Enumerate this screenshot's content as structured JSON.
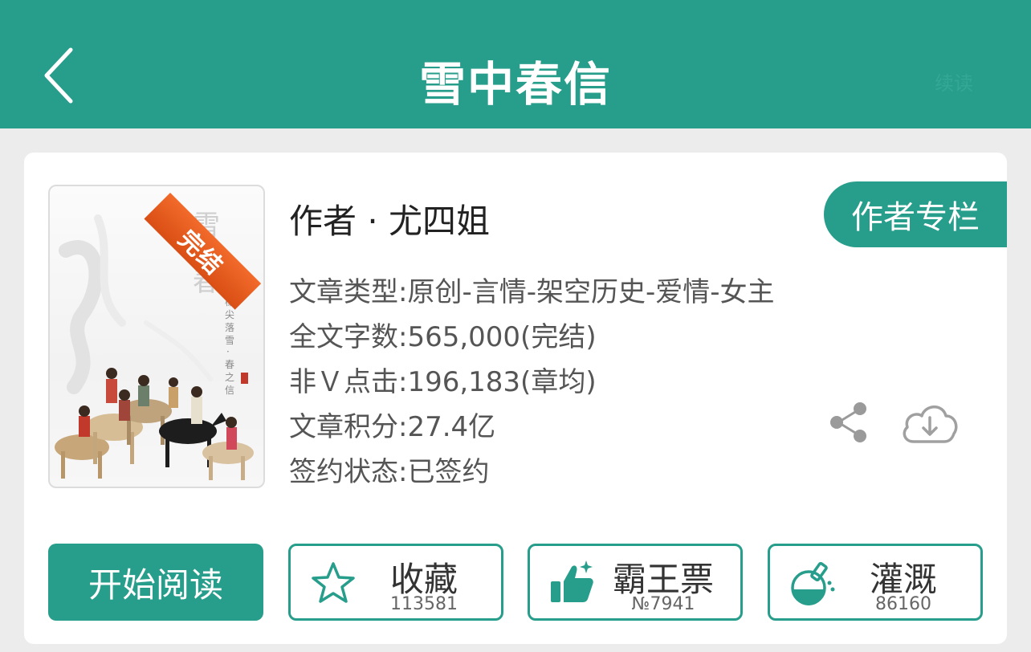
{
  "header": {
    "title": "雪中春信",
    "faint_label": "续读"
  },
  "book": {
    "status_ribbon": "完结",
    "author": "作者 · 尤四姐",
    "author_column_label": "作者专栏",
    "info": [
      "文章类型:原创-言情-架空历史-爱情-女主",
      "全文字数:565,000(完结)",
      "非Ｖ点击:196,183(章均)",
      "文章积分:27.4亿",
      "签约状态:已签约"
    ]
  },
  "actions": {
    "read_label": "开始阅读",
    "favorite": {
      "label": "收藏",
      "count": "113581"
    },
    "bawangpiao": {
      "label": "霸王票",
      "count": "№7941"
    },
    "irrigate": {
      "label": "灌溉",
      "count": "86160"
    }
  },
  "colors": {
    "accent": "#279d8b",
    "ribbon": "#e0561a"
  },
  "icons": [
    "back-icon",
    "share-icon",
    "download-cloud-icon",
    "star-icon",
    "thumbs-up-icon",
    "flask-icon"
  ]
}
